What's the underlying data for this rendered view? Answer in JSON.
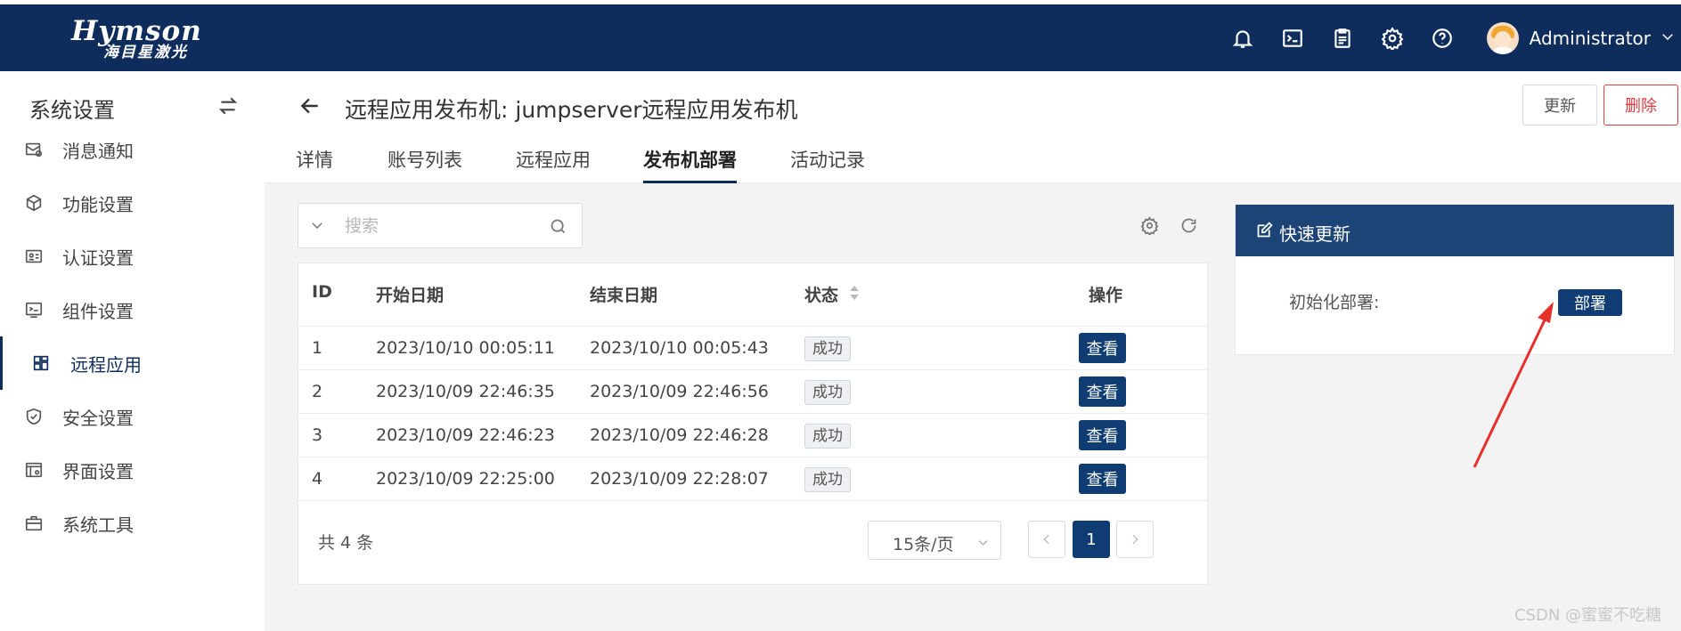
{
  "header": {
    "logo_brand": "Hymson",
    "logo_sub": "海目星激光",
    "icons": [
      "bell-icon",
      "terminal-icon",
      "clipboard-icon",
      "gear-icon",
      "help-icon"
    ],
    "username": "Administrator",
    "bg_color": "#0e2d5c"
  },
  "sidebar": {
    "title": "系统设置",
    "items": [
      {
        "label": "消息通知",
        "icon": "message-settings-icon"
      },
      {
        "label": "功能设置",
        "icon": "cube-icon"
      },
      {
        "label": "认证设置",
        "icon": "id-card-icon"
      },
      {
        "label": "组件设置",
        "icon": "terminal-icon"
      },
      {
        "label": "远程应用",
        "icon": "apps-icon",
        "active": true
      },
      {
        "label": "安全设置",
        "icon": "shield-icon"
      },
      {
        "label": "界面设置",
        "icon": "layout-icon"
      },
      {
        "label": "系统工具",
        "icon": "toolbox-icon"
      }
    ]
  },
  "page": {
    "title": "远程应用发布机: jumpserver远程应用发布机",
    "update_label": "更新",
    "delete_label": "删除",
    "tabs": [
      "详情",
      "账号列表",
      "远程应用",
      "发布机部署",
      "活动记录"
    ],
    "active_tab": "发布机部署"
  },
  "search": {
    "placeholder": "搜索"
  },
  "table": {
    "columns": [
      "ID",
      "开始日期",
      "结束日期",
      "状态",
      "操作"
    ],
    "rows": [
      {
        "id": "1",
        "start": "2023/10/10 00:05:11",
        "end": "2023/10/10 00:05:43",
        "status": "成功",
        "action": "查看"
      },
      {
        "id": "2",
        "start": "2023/10/09 22:46:35",
        "end": "2023/10/09 22:46:56",
        "status": "成功",
        "action": "查看"
      },
      {
        "id": "3",
        "start": "2023/10/09 22:46:23",
        "end": "2023/10/09 22:46:28",
        "status": "成功",
        "action": "查看"
      },
      {
        "id": "4",
        "start": "2023/10/09 22:25:00",
        "end": "2023/10/09 22:28:07",
        "status": "成功",
        "action": "查看"
      }
    ],
    "total": "共 4 条",
    "page_size": "15条/页",
    "current_page": "1"
  },
  "quick_update": {
    "title": "快速更新",
    "label": "初始化部署:",
    "button": "部署"
  },
  "watermark": "CSDN @蜜蜜不吃糖",
  "colors": {
    "accent": "#0e3c73",
    "danger": "#e0393e",
    "annotation": "#e8302a"
  }
}
